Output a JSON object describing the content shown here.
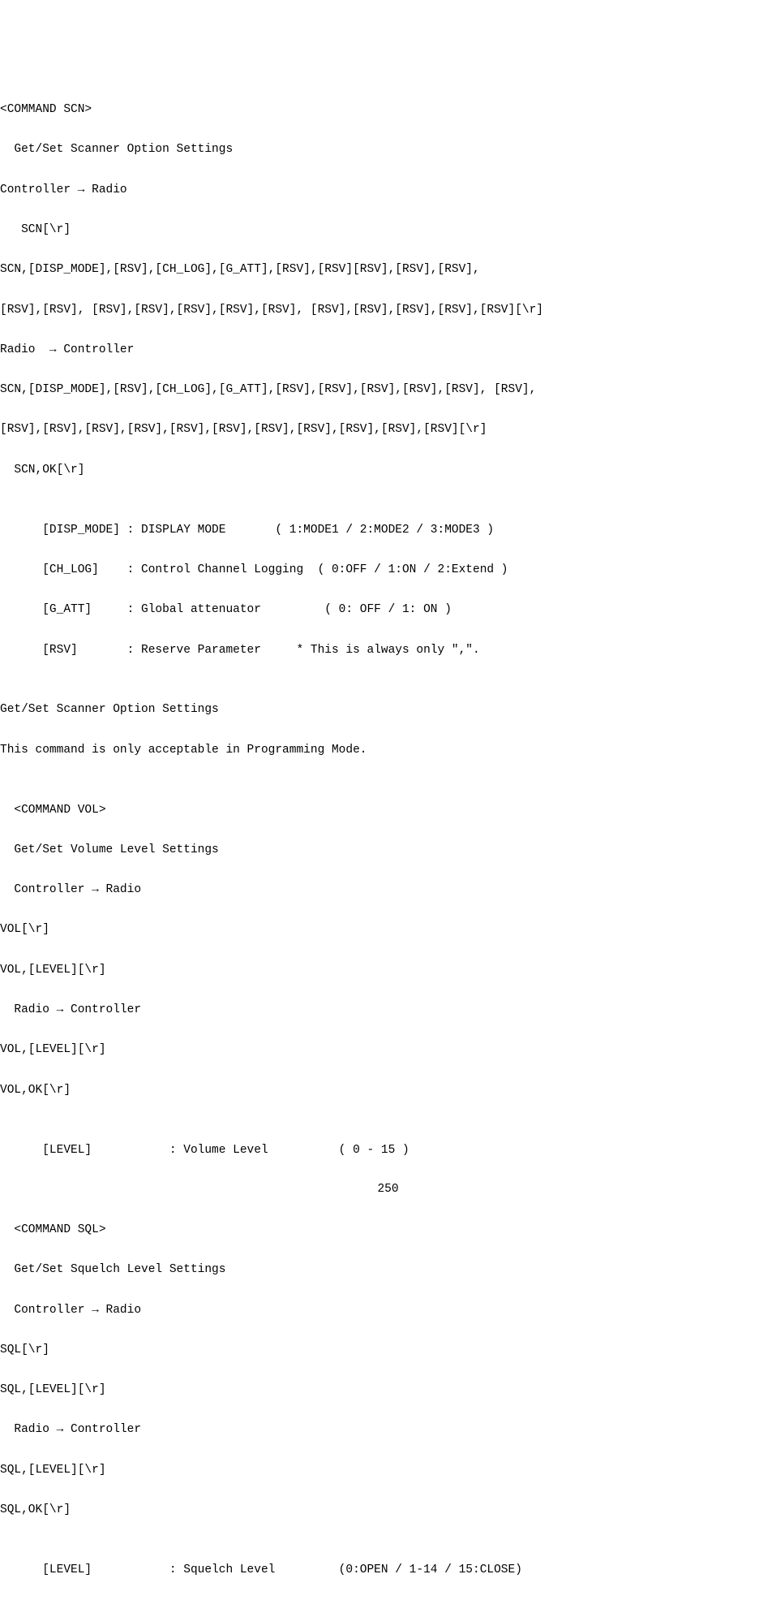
{
  "page_number": "250",
  "scn": {
    "header": "<COMMAND SCN>",
    "title": "  Get/Set Scanner Option Settings",
    "ctr_to_radio_label": "Controller → Radio",
    "ctr_to_radio_req": "   SCN[\\r]",
    "ctr_to_radio_body_l1": "SCN,[DISP_MODE],[RSV],[CH_LOG],[G_ATT],[RSV],[RSV][RSV],[RSV],[RSV],",
    "ctr_to_radio_body_l2": "[RSV],[RSV], [RSV],[RSV],[RSV],[RSV],[RSV], [RSV],[RSV],[RSV],[RSV],[RSV][\\r]",
    "radio_to_ctr_label": "Radio  → Controller",
    "radio_to_ctr_body_l1": "SCN,[DISP_MODE],[RSV],[CH_LOG],[G_ATT],[RSV],[RSV],[RSV],[RSV],[RSV], [RSV],",
    "radio_to_ctr_body_l2": "[RSV],[RSV],[RSV],[RSV],[RSV],[RSV],[RSV],[RSV],[RSV],[RSV],[RSV][\\r]",
    "radio_to_ctr_ok": "  SCN,OK[\\r]",
    "params": {
      "disp_mode": "      [DISP_MODE] : DISPLAY MODE       ( 1:MODE1 / 2:MODE2 / 3:MODE3 )",
      "ch_log": "      [CH_LOG]    : Control Channel Logging  ( 0:OFF / 1:ON / 2:Extend )",
      "g_att": "      [G_ATT]     : Global attenuator         ( 0: OFF / 1: ON )",
      "rsv": "      [RSV]       : Reserve Parameter     * This is always only \",\"."
    },
    "note_l1": "Get/Set Scanner Option Settings",
    "note_l2": "This command is only acceptable in Programming Mode."
  },
  "vol": {
    "header": "  <COMMAND VOL>",
    "title": "  Get/Set Volume Level Settings",
    "ctr_to_radio_label": "  Controller → Radio",
    "req_l1": "VOL[\\r]",
    "req_l2": "VOL,[LEVEL][\\r]",
    "radio_to_ctr_label": "  Radio → Controller",
    "resp_l1": "VOL,[LEVEL][\\r]",
    "resp_l2": "VOL,OK[\\r]",
    "param_level": "      [LEVEL]           : Volume Level          ( 0 - 15 )"
  },
  "sql": {
    "header": "  <COMMAND SQL>",
    "title": "  Get/Set Squelch Level Settings",
    "ctr_to_radio_label": "  Controller → Radio",
    "req_l1": "SQL[\\r]",
    "req_l2": "SQL,[LEVEL][\\r]",
    "radio_to_ctr_label": "  Radio → Controller",
    "resp_l1": "SQL,[LEVEL][\\r]",
    "resp_l2": "SQL,OK[\\r]",
    "param_level": "      [LEVEL]           : Squelch Level         (0:OPEN / 1-14 / 15:CLOSE)"
  }
}
